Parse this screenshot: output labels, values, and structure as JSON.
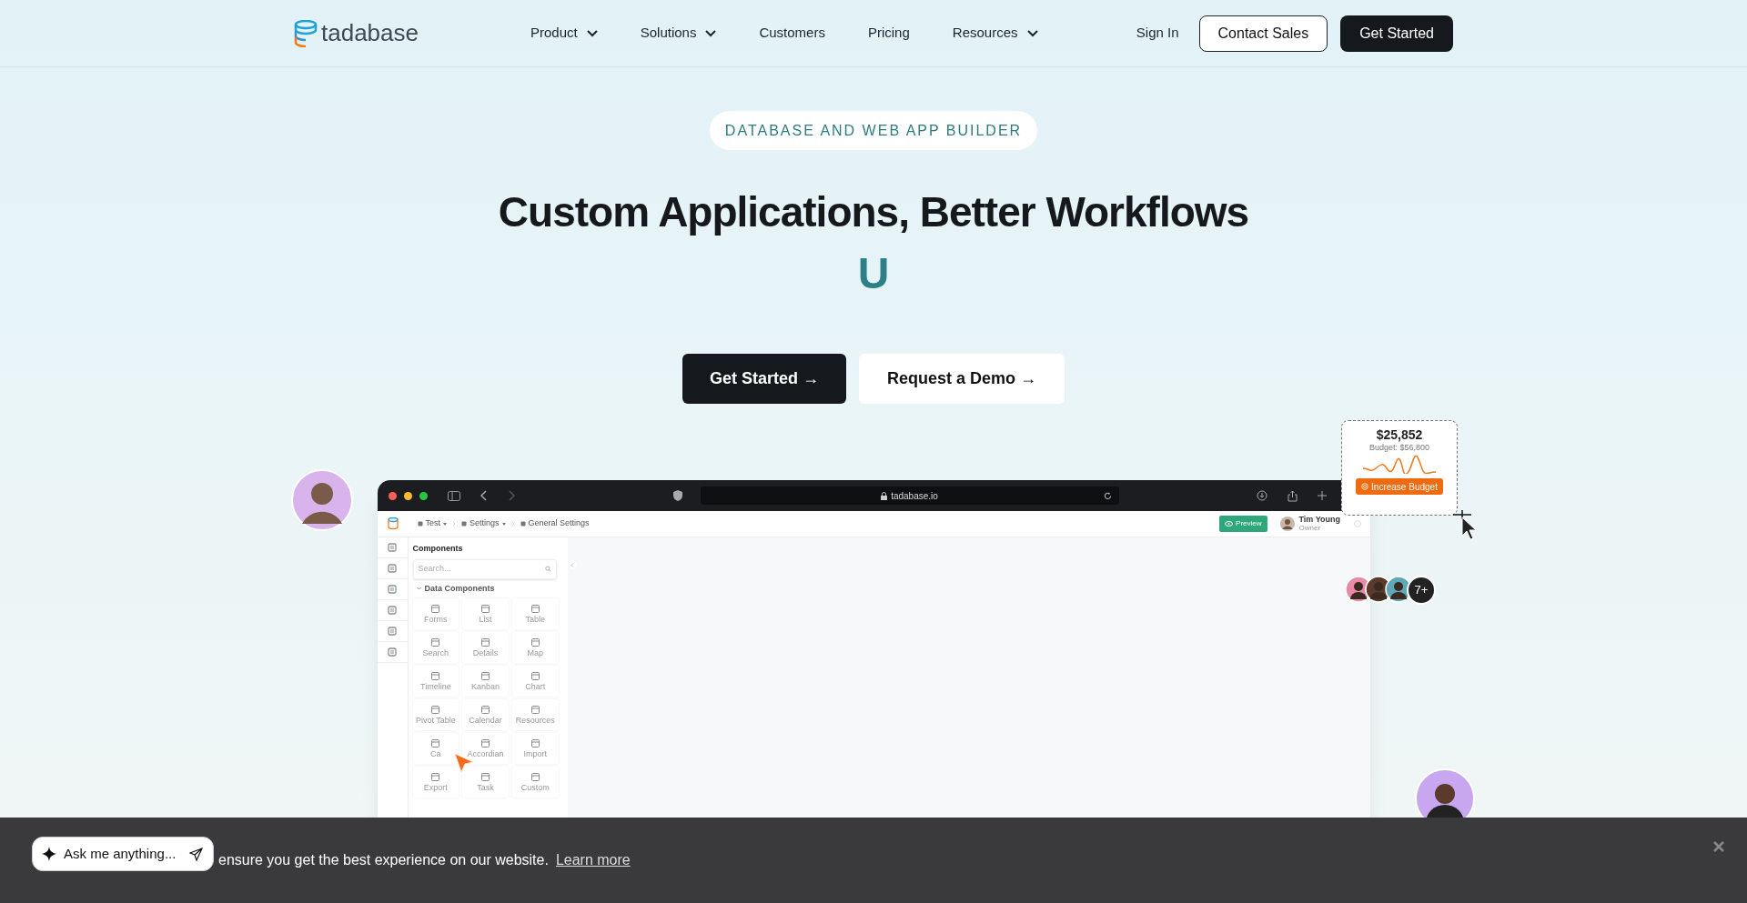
{
  "nav": {
    "logo": "tadabase",
    "items": [
      {
        "label": "Product",
        "dropdown": true
      },
      {
        "label": "Solutions",
        "dropdown": true
      },
      {
        "label": "Customers",
        "dropdown": false
      },
      {
        "label": "Pricing",
        "dropdown": false
      },
      {
        "label": "Resources",
        "dropdown": true
      }
    ],
    "sign_in": "Sign In",
    "contact": "Contact Sales",
    "cta": "Get Started"
  },
  "hero": {
    "badge": "DATABASE AND WEB APP BUILDER",
    "title": "Custom Applications, Better Workflows",
    "typed": "U",
    "buttons": [
      {
        "label": "Get Started →",
        "kind": "primary"
      },
      {
        "label": "Request a Demo →",
        "kind": "secondary"
      }
    ]
  },
  "browser": {
    "url": "tadabase.io"
  },
  "app": {
    "breadcrumb": [
      {
        "label": "Test",
        "dropdown": true
      },
      {
        "label": "Settings",
        "dropdown": true
      },
      {
        "label": "General Settings",
        "dropdown": false
      }
    ],
    "preview": "Preview",
    "user": {
      "name": "Tim Young",
      "role": "Owner"
    },
    "panel_title": "Components",
    "search_placeholder": "Search...",
    "section": "Data Components",
    "components": [
      "Forms",
      "List",
      "Table",
      "Search",
      "Details",
      "Map",
      "Timeline",
      "Kanban",
      "Chart",
      "Pivot Table",
      "Calendar",
      "Resources",
      "Ca",
      "Accordian",
      "Import",
      "Export",
      "Task",
      "Custom"
    ]
  },
  "budget_card": {
    "amount": "$25,852",
    "budget": "Budget: $56,800",
    "button": "Increase Budget"
  },
  "collaborators": {
    "avatars": [
      {
        "color": "#e98aa8"
      },
      {
        "color": "#5a3a2a"
      },
      {
        "color": "#5fa8b8"
      }
    ],
    "more": "7+"
  },
  "cookie": {
    "text": "ensure you get the best experience on our website.",
    "link": "Learn more"
  },
  "chat": {
    "placeholder": "Ask me anything..."
  }
}
